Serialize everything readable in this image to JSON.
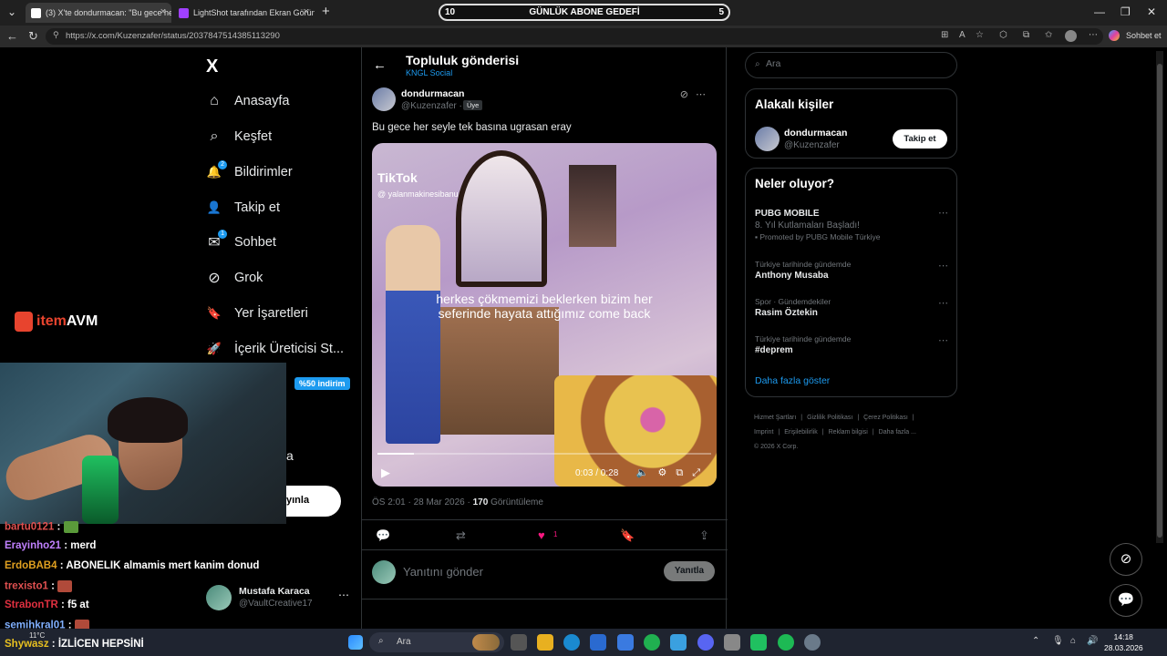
{
  "browser": {
    "tabs": [
      {
        "title": "(3) X'te dondurmacan: \"Bu gece he",
        "active": true
      },
      {
        "title": "LightShot tarafından Ekran Görünt",
        "active": false
      }
    ],
    "new_tab": "+",
    "url": "https://x.com/Kuzenzafer/status/2037847514385113290",
    "chat_button": "Sohbet et"
  },
  "overlay": {
    "goal_left": "10",
    "goal_label": "GÜNLÜK ABONE GEDEFİ",
    "goal_right": "5",
    "brand_item": "item",
    "brand_avm": "AVM",
    "chat": [
      {
        "user": "bartu0121",
        "message": "",
        "color": "#e05050"
      },
      {
        "user": "Erayinho21",
        "message": "merd",
        "color": "#c080ff"
      },
      {
        "user": "ErdoBAB4",
        "message": "ABONELIK almamis mert kanim donud",
        "color": "#e0a020"
      },
      {
        "user": "trexisto1",
        "message": "",
        "color": "#e05050"
      },
      {
        "user": "StrabonTR",
        "message": "f5 at",
        "color": "#e03040"
      },
      {
        "user": "semihkral01",
        "message": "",
        "color": "#80b0ff"
      }
    ],
    "bottom_user": "Shywasz",
    "bottom_text": "İZLİCEN HEPSİNİ",
    "weather": "11°C"
  },
  "sidebar": {
    "logo": "X",
    "items": [
      {
        "label": "Anasayfa",
        "icon": "home-icon",
        "glyph": "⌂"
      },
      {
        "label": "Keşfet",
        "icon": "search-icon",
        "glyph": "⌕"
      },
      {
        "label": "Bildirimler",
        "icon": "bell-icon",
        "glyph": "🔔",
        "badge": "2"
      },
      {
        "label": "Takip et",
        "icon": "follow-icon",
        "glyph": "👤"
      },
      {
        "label": "Sohbet",
        "icon": "mail-icon",
        "glyph": "✉",
        "badge": "1"
      },
      {
        "label": "Grok",
        "icon": "grok-icon",
        "glyph": "⊘"
      },
      {
        "label": "Yer İşaretleri",
        "icon": "bookmark-icon",
        "glyph": "🔖"
      },
      {
        "label": "İçerik Üreticisi St...",
        "icon": "rocket-icon",
        "glyph": "🚀"
      }
    ],
    "discount": "%50 indirim",
    "partial_label": "a",
    "post_button": "yınla",
    "account": {
      "name": "Mustafa Karaca",
      "handle": "@VaultCreative17"
    }
  },
  "post": {
    "header_title": "Topluluk gönderisi",
    "header_sub": "KNGL Social",
    "author_name": "dondurmacan",
    "author_handle": "@Kuzenzafer ·",
    "member_tag": "Üye",
    "text": "Bu gece her seyle tek basına ugrasan eray",
    "video": {
      "watermark": "TikTok",
      "watermark_handle": "@ yalanmakinesibanu",
      "caption": "herkes çökmemizi beklerken bizim her seferinde hayata attığımız come back",
      "time": "0:03 / 0:28",
      "progress": 0.11
    },
    "meta_time": "ÖS 2:01 · 28 Mar 2026 · ",
    "views_count": "170",
    "views_label": " Görüntüleme",
    "like_count": "1",
    "reply_placeholder": "Yanıtını gönder",
    "reply_button": "Yanıtla"
  },
  "right": {
    "search_placeholder": "Ara",
    "related_title": "Alakalı kişiler",
    "related_name": "dondurmacan",
    "related_handle": "@Kuzenzafer",
    "follow_button": "Takip et",
    "trends_title": "Neler oluyor?",
    "trends": [
      {
        "context": "",
        "topic": "PUBG MOBILE",
        "desc": "8. Yıl Kutlamaları Başladı!",
        "promo": "Promoted by PUBG Mobile Türkiye"
      },
      {
        "context": "Türkiye tarihinde gündemde",
        "topic": "Anthony Musaba",
        "desc": "",
        "promo": ""
      },
      {
        "context": "Spor · Gündemdekiler",
        "topic": "Rasim Öztekin",
        "desc": "",
        "promo": ""
      },
      {
        "context": "Türkiye tarihinde gündemde",
        "topic": "#deprem",
        "desc": "",
        "promo": ""
      }
    ],
    "show_more": "Daha fazla göster",
    "footer": [
      "Hizmet Şartları",
      "|",
      "Gizlilik Politikası",
      "|",
      "Çerez Politikası",
      "|",
      "Imprint",
      "|",
      "Erişilebilirlik",
      "|",
      "Reklam bilgisi",
      "|",
      "Daha fazla ...",
      "© 2026 X Corp."
    ]
  },
  "taskbar": {
    "search": "Ara",
    "time": "14:18",
    "date": "28.03.2026"
  }
}
